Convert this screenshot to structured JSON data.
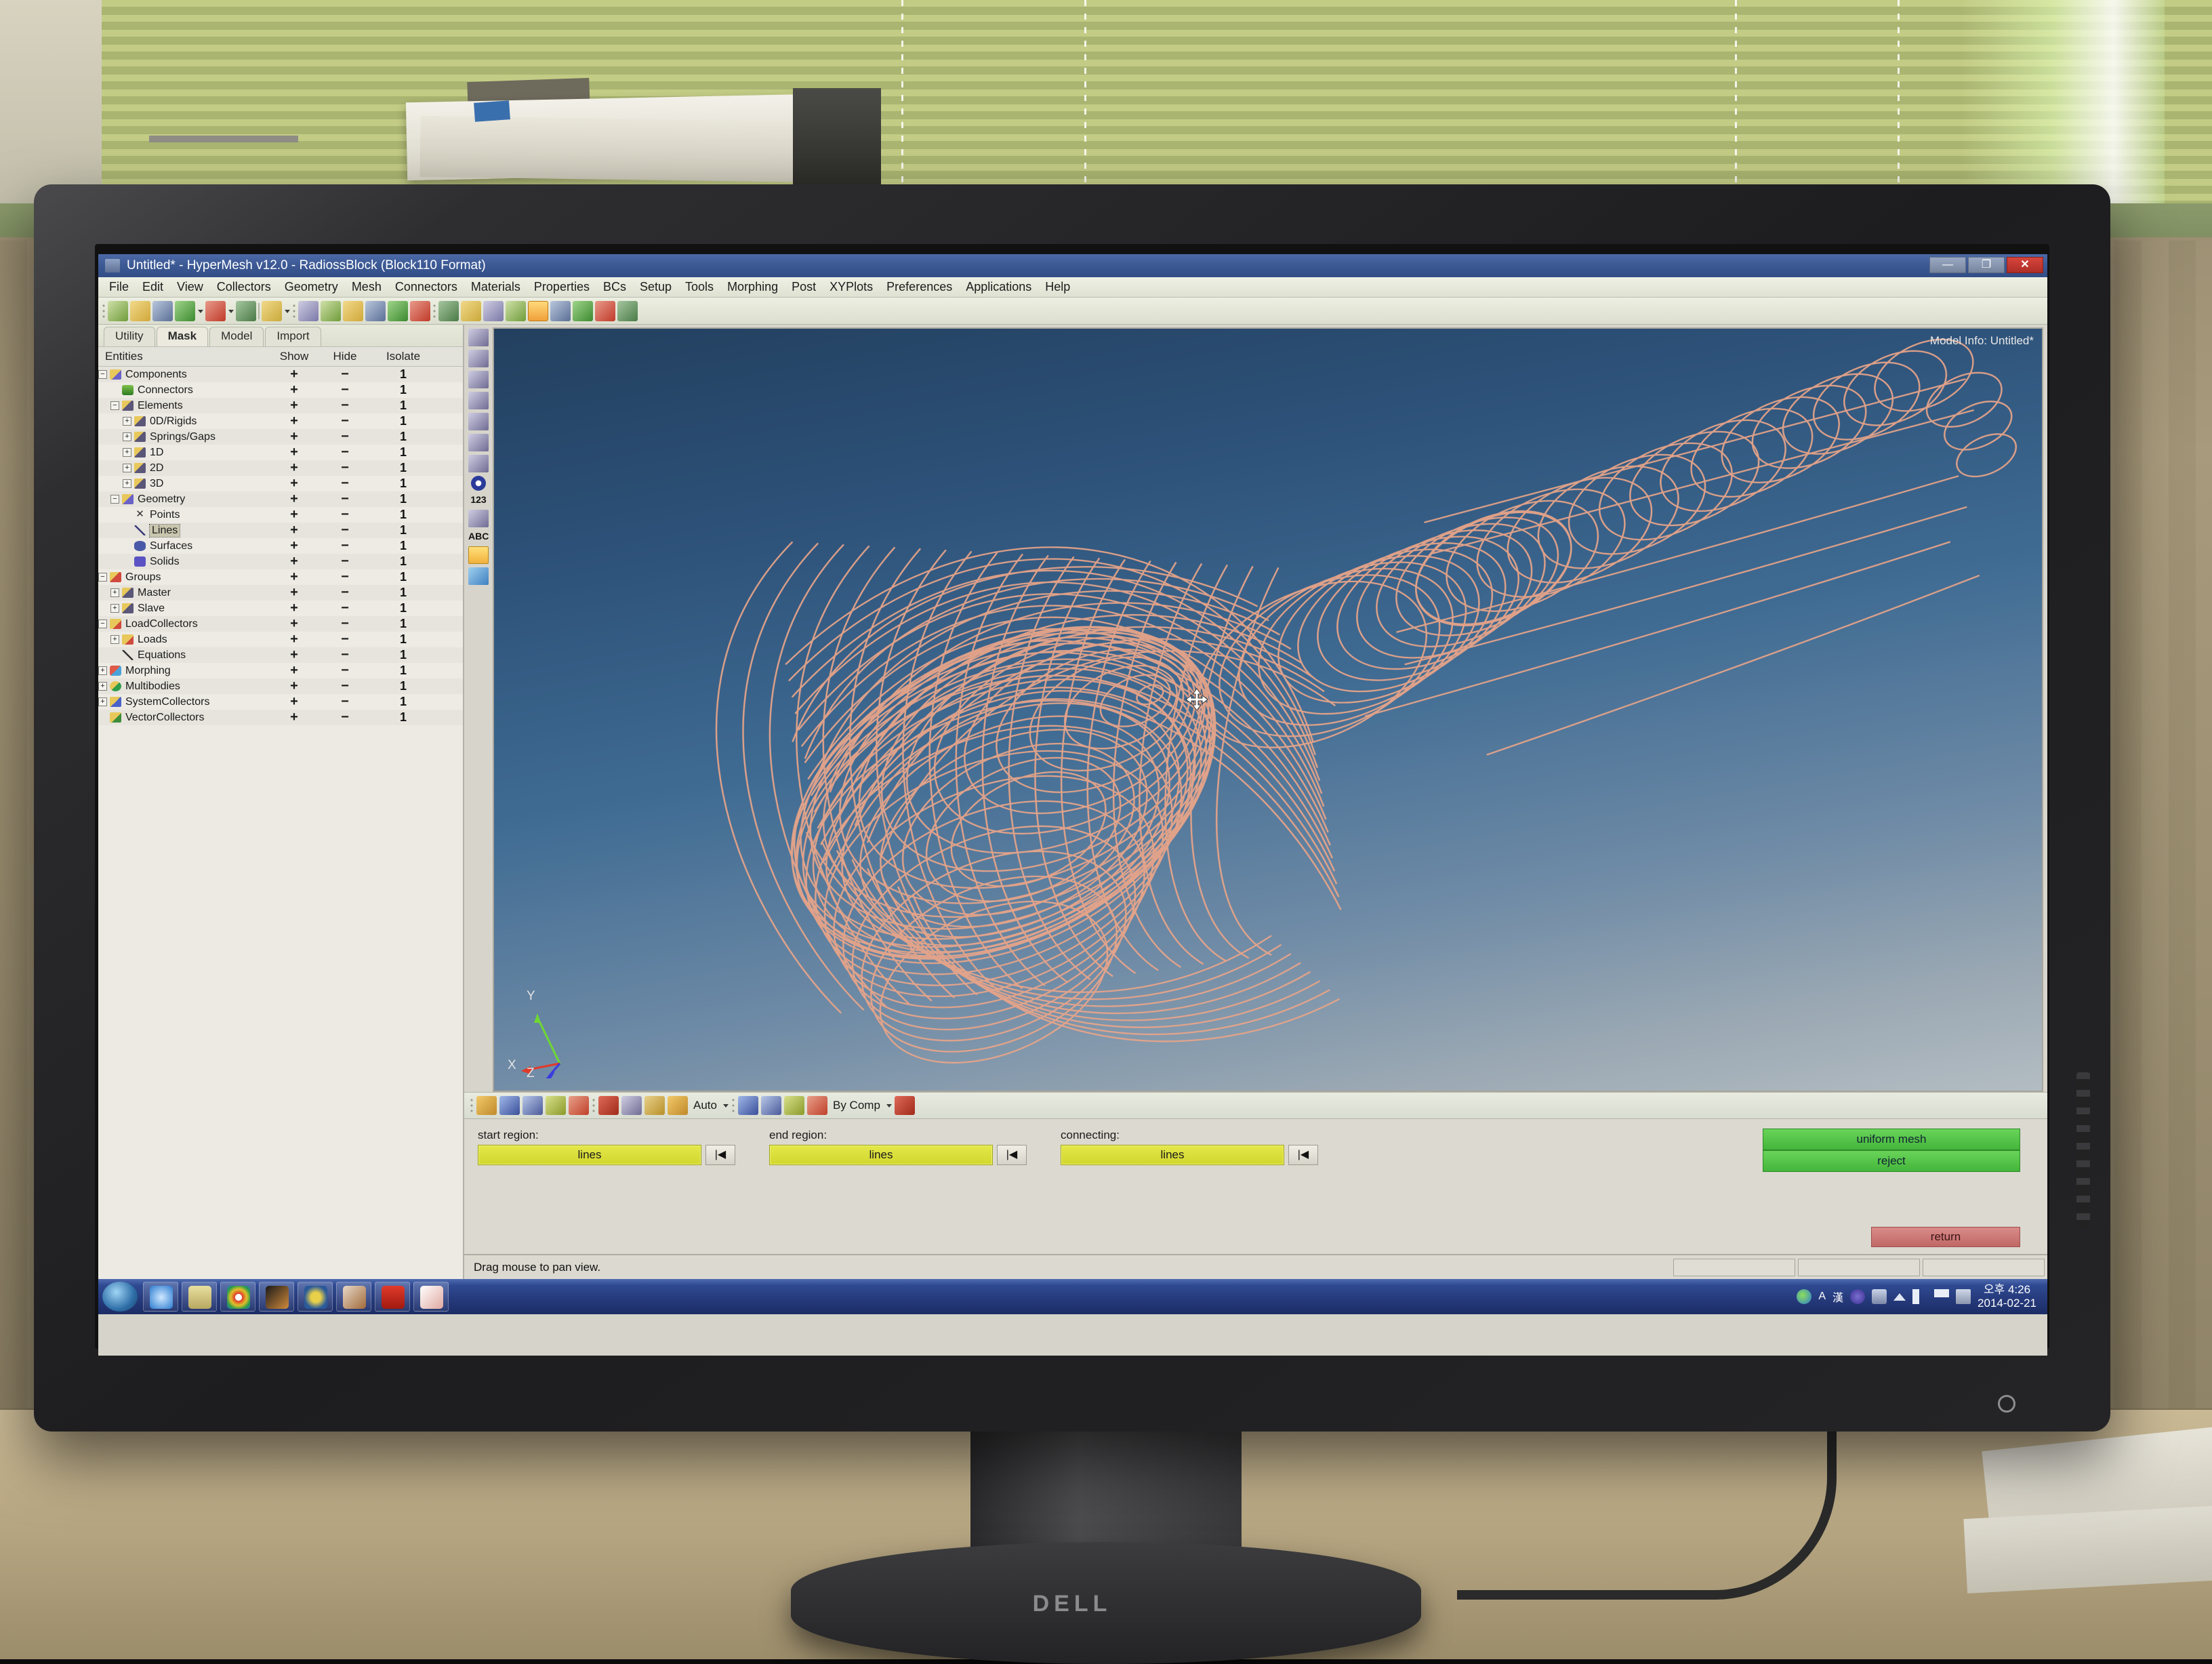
{
  "window": {
    "title": "Untitled* - HyperMesh v12.0 - RadiossBlock (Block110 Format)",
    "minimize": "—",
    "restore": "❐",
    "close": "✕"
  },
  "menu": [
    "File",
    "Edit",
    "View",
    "Collectors",
    "Geometry",
    "Mesh",
    "Connectors",
    "Materials",
    "Properties",
    "BCs",
    "Setup",
    "Tools",
    "Morphing",
    "Post",
    "XYPlots",
    "Preferences",
    "Applications",
    "Help"
  ],
  "toolbar": {
    "icons": [
      "new-model-icon",
      "open-model-icon",
      "save-model-icon",
      "import-icon",
      "export-icon",
      "user-profile-icon",
      "collectors-icon",
      "zoom-fit-icon",
      "back-view-icon",
      "xy-view-icon",
      "yz-view-icon",
      "zx-view-icon",
      "iso-view-icon",
      "rotate-icon",
      "zoom-in-icon",
      "zoom-out-icon",
      "fit-icon",
      "pan-icon",
      "arrow-both-icon",
      "arrow-updown-icon",
      "brace-icon",
      "sphere-icon"
    ],
    "active_tool": "pan-icon"
  },
  "panel_tabs": [
    {
      "label": "Utility",
      "active": false
    },
    {
      "label": "Mask",
      "active": true
    },
    {
      "label": "Model",
      "active": false
    },
    {
      "label": "Import",
      "active": false
    }
  ],
  "tree": {
    "headers": {
      "entities": "Entities",
      "show": "Show",
      "hide": "Hide",
      "isolate": "Isolate"
    },
    "show_symbol": "+",
    "hide_symbol": "−",
    "isolate_value": "1",
    "rows": [
      {
        "label": "Components",
        "indent": 0,
        "expander": "−",
        "icon": "i-comp",
        "selected": false
      },
      {
        "label": "Connectors",
        "indent": 1,
        "expander": "",
        "icon": "i-conn",
        "selected": false
      },
      {
        "label": "Elements",
        "indent": 1,
        "expander": "−",
        "icon": "i-elem",
        "selected": false
      },
      {
        "label": "0D/Rigids",
        "indent": 2,
        "expander": "+",
        "icon": "i-elem",
        "selected": false
      },
      {
        "label": "Springs/Gaps",
        "indent": 2,
        "expander": "+",
        "icon": "i-elem",
        "selected": false
      },
      {
        "label": "1D",
        "indent": 2,
        "expander": "+",
        "icon": "i-elem",
        "selected": false
      },
      {
        "label": "2D",
        "indent": 2,
        "expander": "+",
        "icon": "i-elem",
        "selected": false
      },
      {
        "label": "3D",
        "indent": 2,
        "expander": "+",
        "icon": "i-elem",
        "selected": false
      },
      {
        "label": "Geometry",
        "indent": 1,
        "expander": "−",
        "icon": "i-geom",
        "selected": false
      },
      {
        "label": "Points",
        "indent": 2,
        "expander": "",
        "icon": "i-pt",
        "selected": false
      },
      {
        "label": "Lines",
        "indent": 2,
        "expander": "",
        "icon": "i-ln",
        "selected": true
      },
      {
        "label": "Surfaces",
        "indent": 2,
        "expander": "",
        "icon": "i-srf",
        "selected": false
      },
      {
        "label": "Solids",
        "indent": 2,
        "expander": "",
        "icon": "i-sol",
        "selected": false
      },
      {
        "label": "Groups",
        "indent": 0,
        "expander": "−",
        "icon": "i-grp",
        "selected": false
      },
      {
        "label": "Master",
        "indent": 1,
        "expander": "+",
        "icon": "i-elem",
        "selected": false
      },
      {
        "label": "Slave",
        "indent": 1,
        "expander": "+",
        "icon": "i-elem",
        "selected": false
      },
      {
        "label": "LoadCollectors",
        "indent": 0,
        "expander": "−",
        "icon": "i-load",
        "selected": false
      },
      {
        "label": "Loads",
        "indent": 1,
        "expander": "+",
        "icon": "i-load",
        "selected": false
      },
      {
        "label": "Equations",
        "indent": 1,
        "expander": "",
        "icon": "i-eq",
        "selected": false
      },
      {
        "label": "Morphing",
        "indent": 0,
        "expander": "+",
        "icon": "i-morph",
        "selected": false
      },
      {
        "label": "Multibodies",
        "indent": 0,
        "expander": "+",
        "icon": "i-multi",
        "selected": false
      },
      {
        "label": "SystemCollectors",
        "indent": 0,
        "expander": "+",
        "icon": "i-sys",
        "selected": false
      },
      {
        "label": "VectorCollectors",
        "indent": 0,
        "expander": "",
        "icon": "i-vec",
        "selected": false
      }
    ]
  },
  "viewport": {
    "model_info": "Model Info: Untitled*",
    "axis_x": "X",
    "axis_y": "Y",
    "axis_z": "Z",
    "wireframe_color": "#e8a589",
    "bg_top_color": "#23405f",
    "bg_bottom_color": "#b3bcc2",
    "cursor": "pan-cursor"
  },
  "left_icon_strip": [
    "shrink-wrap-icon",
    "mesh-edit-icon",
    "mesh-display-icon",
    "element-display-icon",
    "mesh-check-icon",
    "mesh-off-icon",
    "binoculars-icon",
    "info-icon",
    "123",
    "node-id-icon",
    "ABC",
    "ABC-load-icon",
    "surface-icon"
  ],
  "mesh_toolbar": {
    "auto_label": "Auto",
    "bycomp_label": "By Comp",
    "icons": [
      "automesh-icon",
      "shrink-icon",
      "solid-map-icon",
      "tetramesh-icon",
      "hexa-icon",
      "delete-icon",
      "edit-element-icon",
      "split-icon",
      "node-edit-icon",
      "element-color-icon",
      "surface-mesh-icon",
      "solid-mesh-icon",
      "mask-icon",
      "3d-view-icon"
    ]
  },
  "panel": {
    "start_region": {
      "label": "start region:",
      "value": "lines",
      "rewind": "|◀"
    },
    "end_region": {
      "label": "end region:",
      "value": "lines",
      "rewind": "|◀"
    },
    "connecting": {
      "label": "connecting:",
      "value": "lines",
      "rewind": "|◀"
    },
    "uniform_mesh_button": "uniform mesh",
    "reject_button": "reject",
    "return_button": "return"
  },
  "statusbar": {
    "message": "Drag mouse to pan view."
  },
  "taskbar": {
    "start": "start-orb-icon",
    "items": [
      "internet-explorer-icon",
      "file-explorer-icon",
      "google-chrome-icon",
      "photo-viewer-icon",
      "media-player-icon",
      "winrar-icon",
      "adobe-reader-icon",
      "hypermesh-icon"
    ],
    "tray_icons": [
      "network-icon",
      "A",
      "漢",
      "help-icon",
      "update-icon",
      "show-hidden-icon",
      "volume-icon",
      "flag-icon",
      "display-icon"
    ],
    "clock_time": "오후 4:26",
    "clock_date": "2014-02-21"
  },
  "monitor": {
    "brand": "DELL"
  }
}
